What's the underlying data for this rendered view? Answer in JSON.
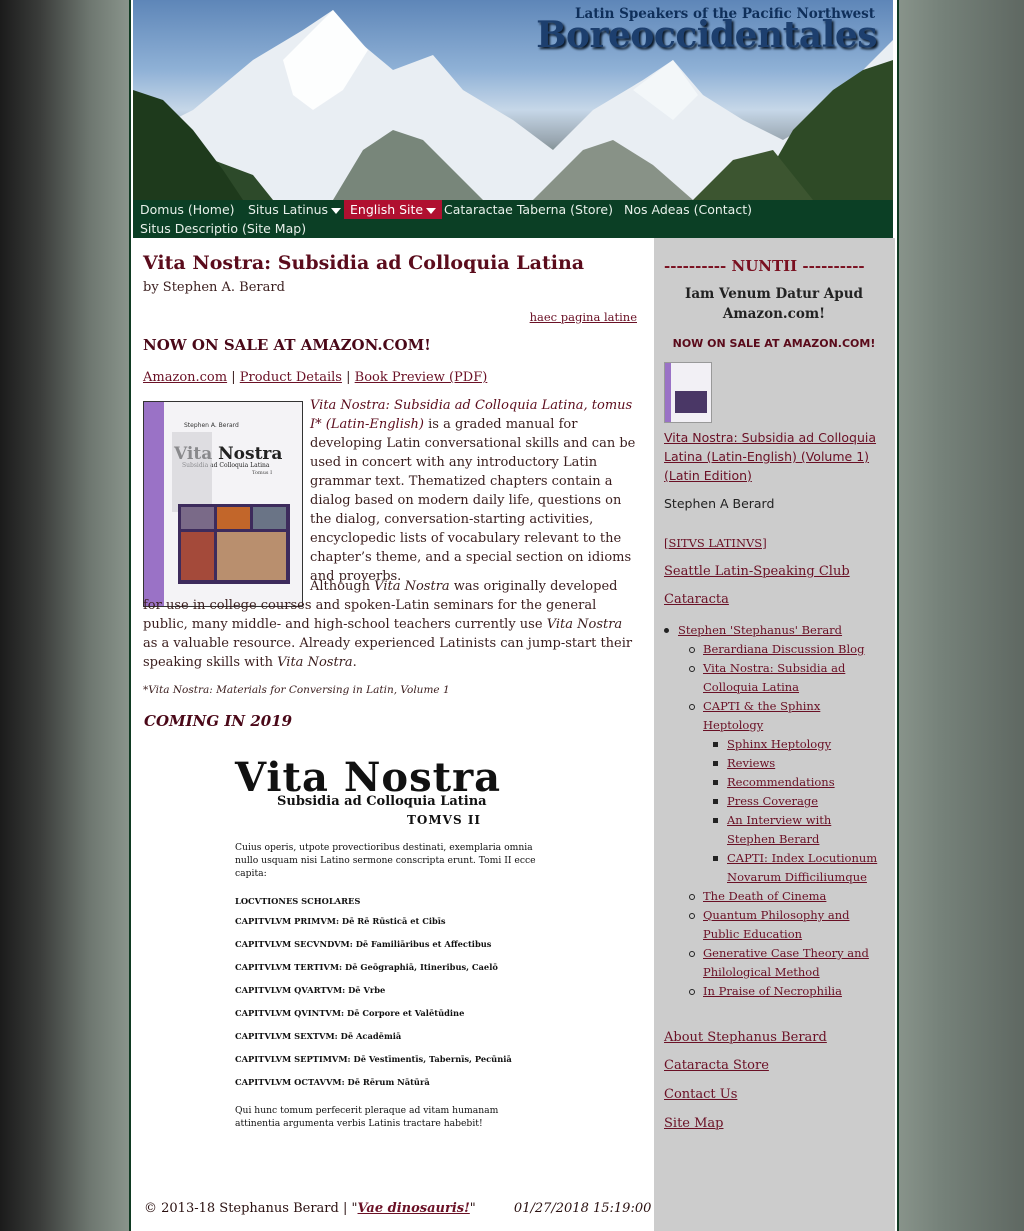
{
  "header": {
    "tagline": "Latin Speakers of the Pacific Northwest",
    "title": "Boreoccidentales"
  },
  "nav": {
    "items": [
      {
        "label": "Domus (Home)"
      },
      {
        "label": "Situs Latinus",
        "dropdown": true
      },
      {
        "label": "English Site",
        "dropdown": true,
        "active": true
      },
      {
        "label": "Cataractae Taberna (Store)"
      },
      {
        "label": "Nos Adeas (Contact)"
      },
      {
        "label": "Situs Descriptio (Site Map)"
      }
    ],
    "active_color": "#b01030"
  },
  "main": {
    "title": "Vita Nostra: Subsidia ad Colloquia Latina",
    "byline": "by Stephen A. Berard",
    "latin_link": "haec pagina latine",
    "sale_heading": "NOW ON SALE AT AMAZON.COM!",
    "links": {
      "amazon": "Amazon.com",
      "sep1": "|",
      "details": "Product Details",
      "sep2": "|",
      "preview": "Book Preview (PDF)"
    },
    "cover": {
      "author": "Stephen A. Berard",
      "title": "Vita Nostra",
      "subtitle": "Subsidia ad Colloquia Latina",
      "tomus": "Tomus I"
    },
    "para1": {
      "book_title": "Vita Nostra: Subsidia ad Colloquia Latina, tomus I* (Latin-English)",
      "text": " is a graded manual for developing Latin conversational skills and can be used in concert with any introductory Latin grammar text. Thematized chapters contain a dialog based on modern daily life, questions on the dialog, conversation-starting activities, encyclopedic lists of vocabulary relevant to the chapter’s theme, and a special section on idioms and proverbs."
    },
    "para2": {
      "t1": "Although ",
      "i1": "Vita Nostra",
      "t2": " was originally developed for use in college courses and spoken-Latin seminars for the general public, many middle- and high-school teachers currently use ",
      "i2": "Vita Nostra",
      "t3": " as a valuable resource. Already experienced Latinists can jump-start their speaking skills with ",
      "i3": "Vita Nostra",
      "t4": "."
    },
    "footnote": "*Vita Nostra: Materials for Conversing in Latin, Volume 1",
    "coming": "COMING IN 2019",
    "vol2": {
      "title": "Vita Nostra",
      "subtitle": "Subsidia ad Colloquia Latina",
      "tomus": "TOMVS II",
      "intro": "Cuius operis, utpote provectioribus destinati, exemplaria omnia nullo usquam nisi Latino sermone conscripta erunt. Tomi II ecce capita:",
      "locutiones": "LOCVTIONES SCHOLARES",
      "chapters": [
        "CAPITVLVM PRIMVM: Dē Rē Rūsticā et Cibīs",
        "CAPITVLVM SECVNDVM: Dē Familiāribus et Affectibus",
        "CAPITVLVM TERTIVM: Dē Geōgraphiā, Itineribus, Caelō",
        "CAPITVLVM QVARTVM: Dē Vrbe",
        "CAPITVLVM QVINTVM: Dē Corpore et Valētūdine",
        "CAPITVLVM SEXTVM: Dē Acadēmiā",
        "CAPITVLVM SEPTIMVM: Dē Vestīmentīs, Tabernīs, Pecūniā",
        "CAPITVLVM OCTAVVM: Dē Rērum Nātūrā"
      ],
      "closing": "Qui hunc tomum perfecerit pleraque ad vitam humanam attinentia argumenta verbis Latinis tractare habebit!"
    },
    "footer": {
      "copyright": "© 2013-18 Stephanus Berard",
      "sep": "|",
      "quote_open": "\"",
      "quote_link": "Vae dinosauris!",
      "quote_close": "\"",
      "timestamp": "01/27/2018 15:19:00"
    }
  },
  "sidebar": {
    "nuntii": "---------- NUNTII ----------",
    "iam": "Iam Venum Datur Apud Amazon.com!",
    "sale": "NOW ON SALE AT AMAZON.COM!",
    "book_link": "Vita Nostra: Subsidia ad Colloquia Latina (Latin-English) (Volume 1) (Latin Edition)",
    "author": "Stephen A Berard",
    "situs_latinus": "[SITVS LATINVS]",
    "seattle": "Seattle Latin-Speaking Club",
    "cataracta": "Cataracta",
    "tree": {
      "root": "Stephen 'Stephanus' Berard",
      "level1a": [
        "Berardiana Discussion Blog",
        "Vita Nostra: Subsidia ad Colloquia Latina",
        "CAPTI & the Sphinx Heptology"
      ],
      "level2": [
        "Sphinx Heptology",
        "Reviews",
        "Recommendations",
        "Press Coverage",
        "An Interview with Stephen Berard",
        "CAPTI: Index Locutionum Novarum Difficiliumque"
      ],
      "level1b": [
        "The Death of Cinema",
        "Quantum Philosophy and Public Education",
        "Generative Case Theory and Philological Method",
        "In Praise of Necrophilia"
      ]
    },
    "about": "About Stephanus Berard",
    "store": "Cataracta Store",
    "contact": "Contact Us",
    "sitemap": "Site Map"
  }
}
